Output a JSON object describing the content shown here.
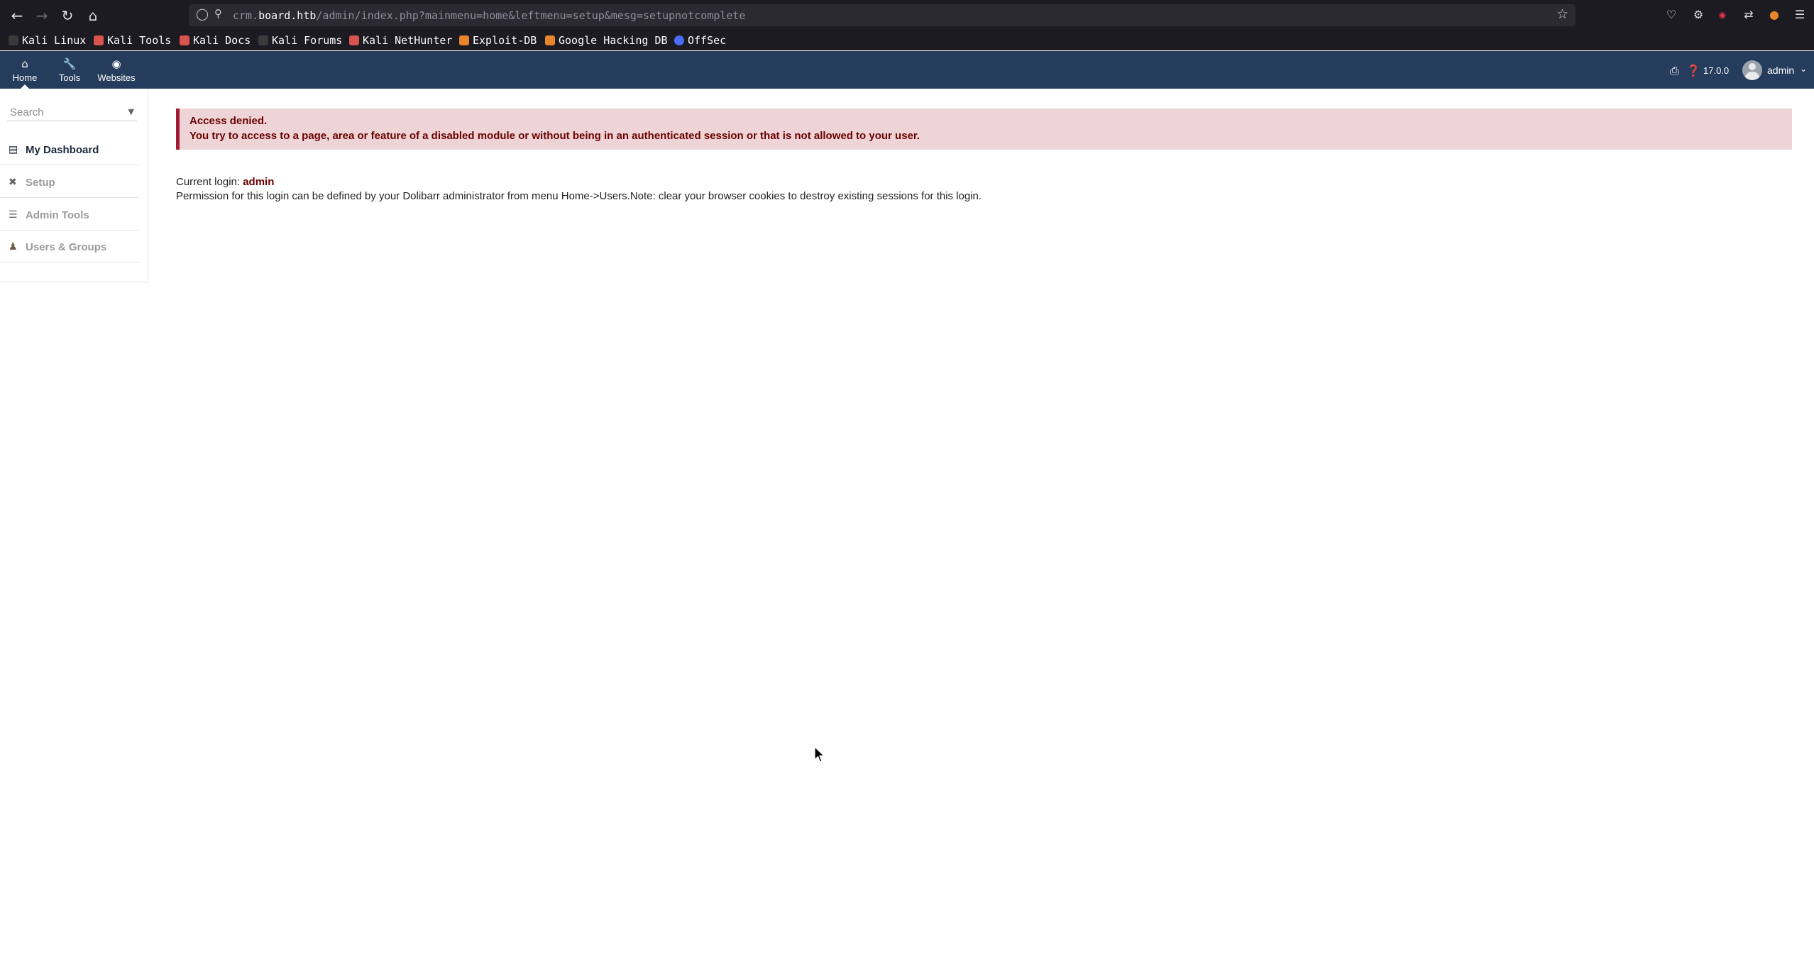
{
  "browser": {
    "url_host_prefix": "crm.",
    "url_host": "board.htb",
    "url_path": "/admin/index.php?mainmenu=home&leftmenu=setup&mesg=setupnotcomplete",
    "icons": [
      "back-icon",
      "forward-icon",
      "reload-icon",
      "home-icon",
      "shield-icon",
      "lock-icon",
      "star-icon",
      "pocket-icon",
      "extensions-icon",
      "ublock-icon",
      "sync-icon",
      "account-icon",
      "menu-icon"
    ]
  },
  "bookmarks": [
    {
      "label": "Kali Linux",
      "color": "#3a3a3a"
    },
    {
      "label": "Kali Tools",
      "color": "#d9534f"
    },
    {
      "label": "Kali Docs",
      "color": "#d9534f"
    },
    {
      "label": "Kali Forums",
      "color": "#3a3a3a"
    },
    {
      "label": "Kali NetHunter",
      "color": "#d9534f"
    },
    {
      "label": "Exploit-DB",
      "color": "#e8842c"
    },
    {
      "label": "Google Hacking DB",
      "color": "#e8842c"
    },
    {
      "label": "OffSec",
      "color": "#4a6cf7"
    }
  ],
  "topmenu": {
    "items": [
      {
        "label": "Home",
        "icon": "home-icon",
        "active": true
      },
      {
        "label": "Tools",
        "icon": "wrench-icon",
        "active": false
      },
      {
        "label": "Websites",
        "icon": "globe-icon",
        "active": false
      }
    ],
    "version": "17.0.0",
    "user": "admin"
  },
  "leftmenu": {
    "search_placeholder": "Search",
    "items": [
      {
        "label": "My Dashboard",
        "icon": "chart-icon",
        "current": true
      },
      {
        "label": "Setup",
        "icon": "tools-icon",
        "current": false
      },
      {
        "label": "Admin Tools",
        "icon": "list-icon",
        "current": false
      },
      {
        "label": "Users & Groups",
        "icon": "user-icon",
        "current": false
      }
    ]
  },
  "main": {
    "alert_title": "Access denied.",
    "alert_message": "You try to access to a page, area or feature of a disabled module or without being in an authenticated session or that is not allowed to your user.",
    "login_label": "Current login: ",
    "login_user": "admin",
    "permission_note": "Permission for this login can be defined by your Dolibarr administrator from menu Home->Users.Note: clear your browser cookies to destroy existing sessions for this login."
  },
  "colors": {
    "topmenu_bg": "#263c5c",
    "alert_bg": "#eed4d6",
    "alert_border": "#a21b33",
    "alert_text": "#6b0000"
  }
}
